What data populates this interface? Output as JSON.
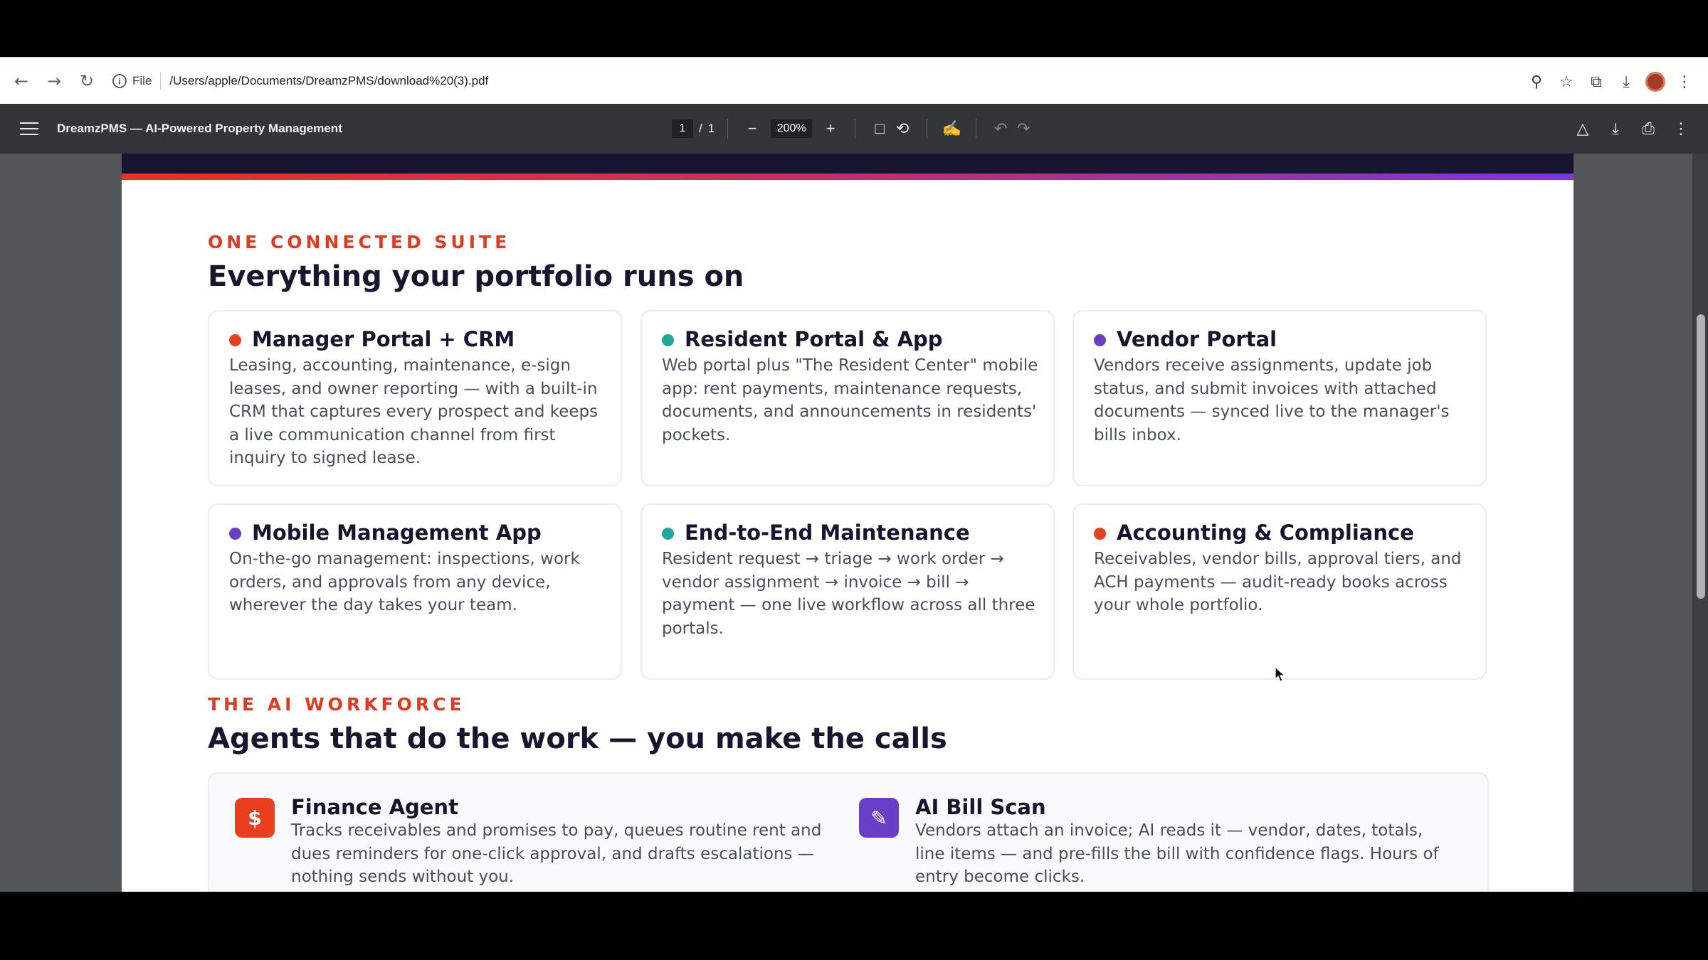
{
  "browser": {
    "scheme_label": "File",
    "url": "/Users/apple/Documents/DreamzPMS/download%20(3).pdf"
  },
  "pdf_toolbar": {
    "title": "DreamzPMS — AI-Powered Property Management",
    "current_page": "1",
    "page_separator": "/",
    "total_pages": "1",
    "zoom": "200%"
  },
  "suite": {
    "eyebrow": "ONE CONNECTED SUITE",
    "heading": "Everything your portfolio runs on",
    "cards": [
      {
        "title": "Manager Portal + CRM",
        "dot_color": "#e5401f",
        "body": "Leasing, accounting, maintenance, e-sign leases, and owner reporting — with a built-in CRM that captures every prospect and keeps a live communication channel from first inquiry to signed lease."
      },
      {
        "title": "Resident Portal & App",
        "dot_color": "#1fa89a",
        "body": "Web portal plus \"The Resident Center\" mobile app: rent payments, maintenance requests, documents, and announcements in residents' pockets."
      },
      {
        "title": "Vendor Portal",
        "dot_color": "#6a3fc8",
        "body": "Vendors receive assignments, update job status, and submit invoices with attached documents — synced live to the manager's bills inbox."
      },
      {
        "title": "Mobile Management App",
        "dot_color": "#6a3fc8",
        "body": "On-the-go management: inspections, work orders, and approvals from any device, wherever the day takes your team."
      },
      {
        "title": "End-to-End Maintenance",
        "dot_color": "#1fa89a",
        "body": "Resident request → triage → work order → vendor assignment → invoice → bill → payment — one live workflow across all three portals."
      },
      {
        "title": "Accounting & Compliance",
        "dot_color": "#e5401f",
        "body": "Receivables, vendor bills, approval tiers, and ACH payments — audit-ready books across your whole portfolio."
      }
    ]
  },
  "workforce": {
    "eyebrow": "THE AI WORKFORCE",
    "heading": "Agents that do the work — you make the calls",
    "agents": [
      {
        "title": "Finance Agent",
        "icon_glyph": "$",
        "icon_name": "dollar-icon",
        "icon_color": "#e8401f",
        "body": "Tracks receivables and promises to pay, queues routine rent and dues reminders for one-click approval, and drafts escalations — nothing sends without you."
      },
      {
        "title": "AI Bill Scan",
        "icon_glyph": "✎",
        "icon_name": "pencil-icon",
        "icon_color": "#6a3fc8",
        "body": "Vendors attach an invoice; AI reads it — vendor, dates, totals, line items — and pre-fills the bill with confidence flags. Hours of entry become clicks."
      }
    ]
  }
}
